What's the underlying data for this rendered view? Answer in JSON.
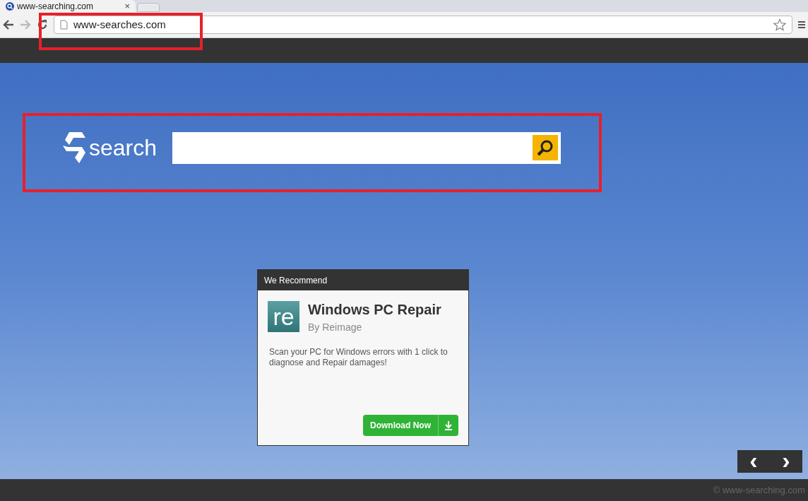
{
  "browser": {
    "tab_title": "www-searching.com",
    "close": "×",
    "url": "www-searches.com"
  },
  "search": {
    "logo_text": "search"
  },
  "ad": {
    "header": "We Recommend",
    "logo": "re",
    "title": "Windows PC Repair",
    "byline": "By Reimage",
    "description": "Scan your PC for Windows errors with 1 click to diagnose and Repair damages!",
    "button": "Download Now"
  },
  "slider": {
    "prev": "‹",
    "next": "›"
  },
  "footer": {
    "copyright": "© www-searching.com"
  }
}
